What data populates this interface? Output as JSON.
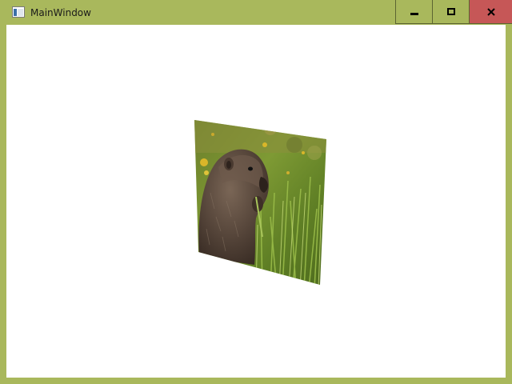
{
  "window": {
    "title": "MainWindow",
    "accent_color": "#a9b85c",
    "close_button_color": "#c65757"
  },
  "caption_buttons": {
    "minimize_icon": "minimize-icon",
    "maximize_icon": "maximize-icon",
    "close_icon": "close-icon"
  },
  "content": {
    "image_subject": "marmot-in-grass-photo",
    "background_color": "#ffffff"
  }
}
